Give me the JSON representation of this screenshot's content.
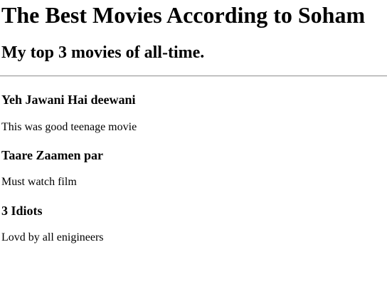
{
  "page": {
    "title": "The Best Movies According to Soham",
    "subtitle": "My top 3 movies of all-time."
  },
  "movies": [
    {
      "title": "Yeh Jawani Hai deewani",
      "description": "This was good teenage movie"
    },
    {
      "title": "Taare Zaamen par",
      "description": "Must watch film"
    },
    {
      "title": "3 Idiots",
      "description": "Lovd by all enigineers"
    }
  ]
}
